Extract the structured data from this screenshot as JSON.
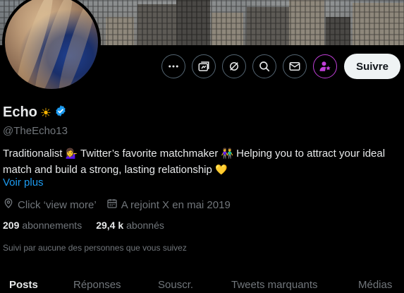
{
  "actions": {
    "more_icon": "more-icon",
    "subscribe_icon": "subscribe-icon",
    "grok_icon": "grok-icon",
    "search_icon": "search-icon",
    "message_icon": "message-icon",
    "star_person_icon": "person-star-icon",
    "follow_label": "Suivre"
  },
  "profile": {
    "display_name": "Echo",
    "name_emoji": "☀",
    "verified": true,
    "handle": "@TheEcho13",
    "bio_part1": "Traditionalist ",
    "bio_emoji1": "💁‍♀️",
    "bio_part2": " Twitter’s favorite matchmaker ",
    "bio_emoji2": "👫",
    "bio_part3": " Helping you to attract your ideal match and build a strong, lasting relationship ",
    "bio_emoji3": "💛",
    "see_more": "Voir plus",
    "location": "Click ‘view more’",
    "joined": "A rejoint X en mai 2019"
  },
  "stats": {
    "following_count": "209",
    "following_label": "abonnements",
    "followers_count": "29,4 k",
    "followers_label": "abonnés"
  },
  "followed_by": "Suivi par aucune des personnes que vous suivez",
  "tabs": [
    "Posts",
    "Réponses",
    "Souscr.",
    "Tweets marquants",
    "Médias"
  ],
  "colors": {
    "background": "#000000",
    "text": "#e7e9ea",
    "muted": "#71767b",
    "link": "#1d9bf0",
    "verified": "#1d9bf0",
    "subscribe_accent": "#c03fd8"
  }
}
